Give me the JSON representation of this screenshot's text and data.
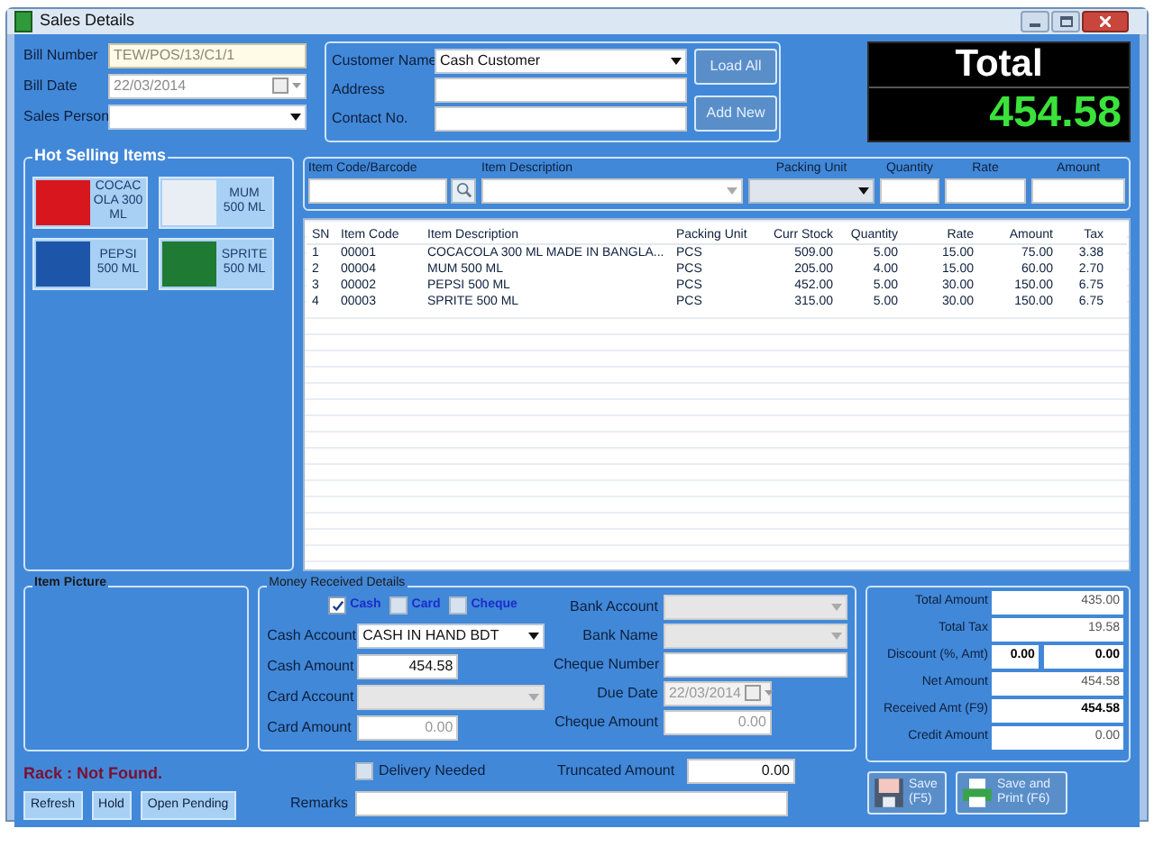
{
  "window": {
    "title": "Sales Details"
  },
  "bill": {
    "fields": [
      {
        "label": "Bill Number",
        "value": "TEW/POS/13/C1/1",
        "kind": "readonly"
      },
      {
        "label": "Bill Date",
        "value": "22/03/2014",
        "kind": "date"
      },
      {
        "label": "Sales Person",
        "kind": "dropdown"
      }
    ]
  },
  "customer": {
    "fields": [
      {
        "label": "Customer Name",
        "value": "Cash Customer",
        "kind": "dropdown"
      },
      {
        "label": "Address",
        "kind": "text"
      },
      {
        "label": "Contact No.",
        "kind": "text"
      }
    ],
    "buttons": [
      "Load All",
      "Add New"
    ]
  },
  "total": {
    "label": "Total",
    "value": "454.58"
  },
  "hot_selling": {
    "title": "Hot Selling Items",
    "items": [
      {
        "label": "COCACOLA 300 ML",
        "color": "#d8161e"
      },
      {
        "label": "MUM 500 ML",
        "color": "#e8eef4"
      },
      {
        "label": "PEPSI 500 ML",
        "color": "#1d56a8"
      },
      {
        "label": "SPRITE 500 ML",
        "color": "#1f7a34"
      }
    ]
  },
  "entry": {
    "columns": [
      {
        "label": "Item Code/Barcode",
        "kind": "search"
      },
      {
        "label": "Item Description",
        "kind": "combo"
      },
      {
        "label": "Packing Unit",
        "kind": "dropdown"
      },
      {
        "label": "Quantity",
        "kind": "text"
      },
      {
        "label": "Rate",
        "kind": "text"
      },
      {
        "label": "Amount",
        "kind": "text"
      }
    ]
  },
  "table": {
    "columns": [
      "SN",
      "Item Code",
      "Item Description",
      "Packing Unit",
      "Curr Stock",
      "Quantity",
      "Rate",
      "Amount",
      "Tax"
    ],
    "rows": [
      [
        "1",
        "00001",
        "COCACOLA 300 ML MADE IN BANGLA...",
        "PCS",
        "509.00",
        "5.00",
        "15.00",
        "75.00",
        "3.38"
      ],
      [
        "2",
        "00004",
        "MUM 500 ML",
        "PCS",
        "205.00",
        "4.00",
        "15.00",
        "60.00",
        "2.70"
      ],
      [
        "3",
        "00002",
        "PEPSI 500 ML",
        "PCS",
        "452.00",
        "5.00",
        "30.00",
        "150.00",
        "6.75"
      ],
      [
        "4",
        "00003",
        "SPRITE 500 ML",
        "PCS",
        "315.00",
        "5.00",
        "30.00",
        "150.00",
        "6.75"
      ]
    ]
  },
  "item_picture": {
    "title": "Item Picture"
  },
  "money": {
    "title": "Money Received Details",
    "methods": [
      {
        "label": "Cash",
        "checked": true
      },
      {
        "label": "Card",
        "checked": false
      },
      {
        "label": "Cheque",
        "checked": false
      }
    ],
    "left_fields": [
      {
        "label": "Cash Account",
        "value": "CASH IN HAND BDT",
        "kind": "dropdown",
        "disabled": false
      },
      {
        "label": "Cash Amount",
        "value": "454.58",
        "kind": "number",
        "disabled": false
      },
      {
        "label": "Card Account",
        "kind": "dropdown",
        "disabled": true
      },
      {
        "label": "Card Amount",
        "value": "0.00",
        "kind": "number",
        "disabled": true
      }
    ],
    "right_fields": [
      {
        "label": "Bank Account",
        "kind": "dropdown",
        "disabled": true
      },
      {
        "label": "Bank Name",
        "kind": "dropdown",
        "disabled": true
      },
      {
        "label": "Cheque Number",
        "kind": "text",
        "disabled": false
      },
      {
        "label": "Due Date",
        "value": "22/03/2014",
        "kind": "date",
        "disabled": true
      },
      {
        "label": "Cheque Amount",
        "value": "0.00",
        "kind": "number",
        "disabled": true
      }
    ]
  },
  "totals": [
    {
      "label": "Total Amount",
      "values": [
        "435.00"
      ],
      "bold": false
    },
    {
      "label": "Total Tax",
      "values": [
        "19.58"
      ],
      "bold": false
    },
    {
      "label": "Discount (%, Amt)",
      "values": [
        "0.00",
        "0.00"
      ],
      "bold": true
    },
    {
      "label": "Net Amount",
      "values": [
        "454.58"
      ],
      "bold": false
    },
    {
      "label": "Received Amt (F9)",
      "values": [
        "454.58"
      ],
      "bold": true
    },
    {
      "label": "Credit Amount",
      "values": [
        "0.00"
      ],
      "bold": false
    }
  ],
  "rack": "Rack : Not Found.",
  "bottom_buttons": [
    "Refresh",
    "Hold",
    "Open Pending"
  ],
  "delivery": {
    "label": "Delivery Needed",
    "checked": false
  },
  "truncated": {
    "label": "Truncated Amount",
    "value": "0.00"
  },
  "remarks": {
    "label": "Remarks"
  },
  "actions": [
    {
      "label": "Save (F5)",
      "kind": "save"
    },
    {
      "label": "Save and Print (F6)",
      "kind": "print"
    }
  ]
}
